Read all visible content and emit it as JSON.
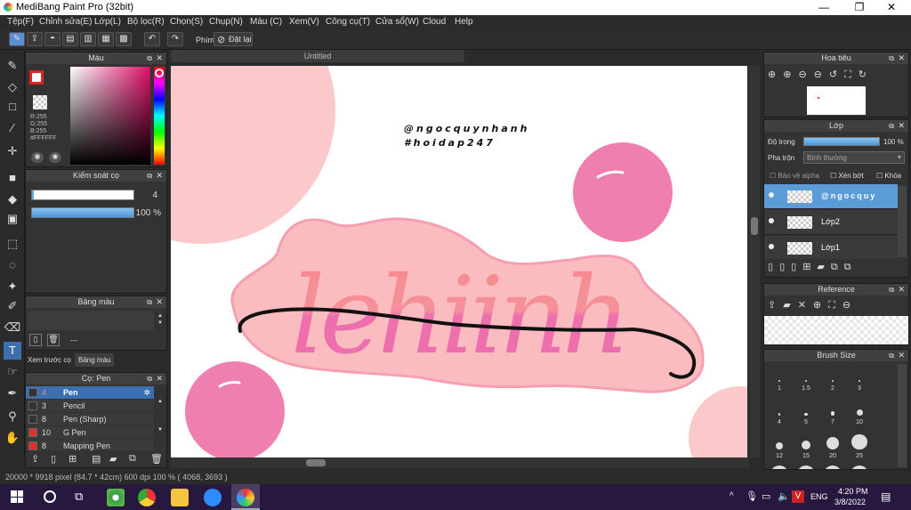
{
  "window": {
    "title": "MediBang Paint Pro (32bit)",
    "minimize": "—",
    "maximize": "❐",
    "close": "✕"
  },
  "menu": [
    "Tệp(F)",
    "Chỉnh sửa(E)",
    "Lớp(L)",
    "Bộ lọc(R)",
    "Chọn(S)",
    "Chụp(N)",
    "Màu (C)",
    "Xem(V)",
    "Công cụ(T)",
    "Cửa sổ(W)",
    "Cloud",
    "Help"
  ],
  "toolbar": {
    "pen_label": "Phím",
    "reset_label": "Đặt lại"
  },
  "color_panel": {
    "title": "Màu",
    "r": "R:255",
    "g": "G:255",
    "b": "B:255",
    "hex": "#FFFFFF"
  },
  "brush_control": {
    "title": "Kiểm soát cọ",
    "size": "4",
    "opacity": "100 %",
    "size_level": 0.02,
    "opacity_level": 1.0
  },
  "palette": {
    "title": "Bảng màu",
    "dash": "---"
  },
  "tabs": {
    "preview": "Xem trước cọ",
    "palette": "Bảng màu"
  },
  "brush_list": {
    "title": "Cọ: Pen",
    "items": [
      {
        "num": "4",
        "name": "Pen",
        "color": "#333333",
        "selected": true
      },
      {
        "num": "3",
        "name": "Pencil",
        "color": "#333333",
        "selected": false
      },
      {
        "num": "8",
        "name": "Pen (Sharp)",
        "color": "#333333",
        "selected": false
      },
      {
        "num": "10",
        "name": "G Pen",
        "color": "#e03030",
        "selected": false
      },
      {
        "num": "8",
        "name": "Mapping Pen",
        "color": "#e03030",
        "selected": false
      }
    ]
  },
  "document": {
    "tab": "Untitled",
    "watermark_line1": "@ngocquynhanh",
    "watermark_line2": "#hoidap247",
    "artwork_text": "lehiinh"
  },
  "navigator": {
    "title": "Hoa tiêu"
  },
  "layers": {
    "title": "Lớp",
    "opacity_label": "Độ trong",
    "opacity_value": "100 %",
    "opacity_level": 1.0,
    "blend_label": "Pha trộn",
    "blend_value": "Bình thường",
    "protect_alpha": "Bảo vệ alpha",
    "clipping": "Xén bớt",
    "lock": "Khóa",
    "items": [
      {
        "name": "@ngocquy",
        "active": true
      },
      {
        "name": "Lớp2",
        "active": false
      },
      {
        "name": "Lớp1",
        "active": false
      }
    ]
  },
  "reference": {
    "title": "Reference"
  },
  "brush_size": {
    "title": "Brush Size",
    "labels": [
      "1",
      "1.5",
      "2",
      "3",
      "4",
      "5",
      "7",
      "10",
      "12",
      "15",
      "20",
      "25"
    ]
  },
  "status": {
    "text": "20000 * 9918 pixel  (84.7 * 42cm)  600 dpi  100 %  ( 4068, 3693 )"
  },
  "taskbar": {
    "lang": "ENG",
    "time": "4:20 PM",
    "date": "3/8/2022"
  }
}
